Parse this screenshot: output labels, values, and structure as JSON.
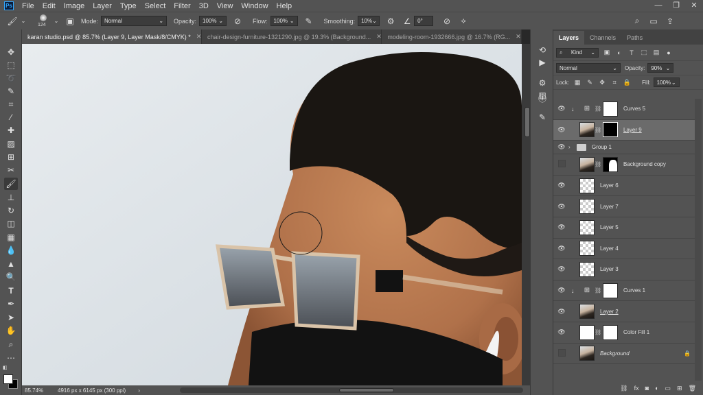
{
  "menubar": {
    "logo": "Ps",
    "items": [
      "File",
      "Edit",
      "Image",
      "Layer",
      "Type",
      "Select",
      "Filter",
      "3D",
      "View",
      "Window",
      "Help"
    ],
    "window_controls": [
      "—",
      "❐",
      "✕"
    ]
  },
  "options": {
    "brush_size": "124",
    "mode_label": "Mode:",
    "mode_value": "Normal",
    "opacity_label": "Opacity:",
    "opacity_value": "100%",
    "flow_label": "Flow:",
    "flow_value": "100%",
    "smoothing_label": "Smoothing:",
    "smoothing_value": "10%",
    "angle_value": "0°"
  },
  "tabs": [
    {
      "label": "karan studio.psd @ 85.7% (Layer 9, Layer Mask/8/CMYK) *",
      "active": true
    },
    {
      "label": "chair-design-furniture-1321290.jpg @ 19.3% (Background...",
      "active": false
    },
    {
      "label": "modeling-room-1932666.jpg @ 16.7% (RG...",
      "active": false
    }
  ],
  "status": {
    "zoom": "85.74%",
    "doc_info": "4916 px x 6145 px (300 ppi)",
    "arrow": "›"
  },
  "panel": {
    "tabs": [
      "Layers",
      "Channels",
      "Paths"
    ],
    "filter_kind": "Kind",
    "blend_mode": "Normal",
    "opacity_label": "Opacity:",
    "opacity_value": "90%",
    "lock_label": "Lock:",
    "fill_label": "Fill:",
    "fill_value": "100%"
  },
  "layers": [
    {
      "name": "Curves 5",
      "visible": true,
      "clipped": true,
      "thumb": "adj",
      "mask": "white",
      "style": ""
    },
    {
      "name": "Layer 9",
      "visible": true,
      "clipped": false,
      "thumb": "photo",
      "mask": "black",
      "style": "ul",
      "selected": true
    },
    {
      "name": "Group 1",
      "visible": true,
      "group": true
    },
    {
      "name": "Background copy",
      "visible": false,
      "clipped": false,
      "thumb": "photo",
      "mask": "maskcopy",
      "style": ""
    },
    {
      "name": "Layer 6",
      "visible": true,
      "clipped": false,
      "thumb": "checker",
      "style": ""
    },
    {
      "name": "Layer 7",
      "visible": true,
      "clipped": false,
      "thumb": "checker",
      "style": ""
    },
    {
      "name": "Layer 5",
      "visible": true,
      "clipped": false,
      "thumb": "checker",
      "style": ""
    },
    {
      "name": "Layer 4",
      "visible": true,
      "clipped": false,
      "thumb": "checker",
      "style": ""
    },
    {
      "name": "Layer 3",
      "visible": true,
      "clipped": false,
      "thumb": "checker",
      "style": ""
    },
    {
      "name": "Curves 1",
      "visible": true,
      "clipped": true,
      "thumb": "adj",
      "mask": "white",
      "style": ""
    },
    {
      "name": "Layer 2",
      "visible": true,
      "clipped": false,
      "thumb": "photo",
      "style": "ul"
    },
    {
      "name": "Color Fill 1",
      "visible": true,
      "clipped": false,
      "thumb": "white",
      "mask": "white",
      "style": ""
    },
    {
      "name": "Background",
      "visible": false,
      "clipped": false,
      "thumb": "photo",
      "style": "italic",
      "locked": true
    }
  ]
}
